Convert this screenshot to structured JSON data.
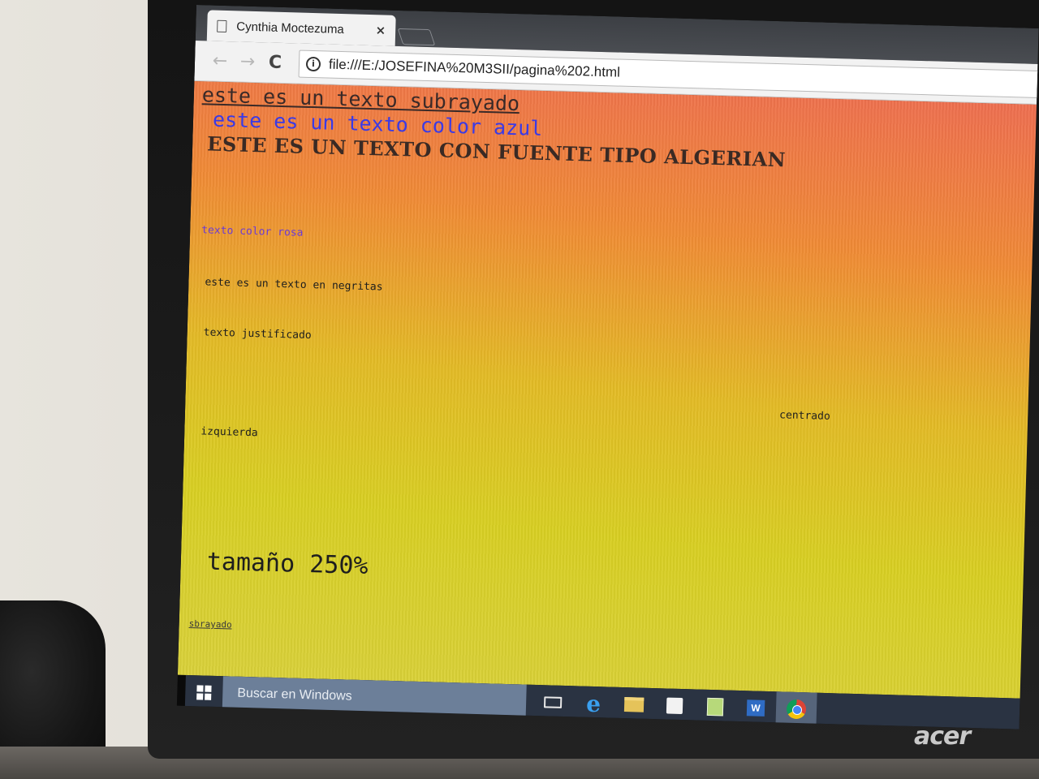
{
  "browser": {
    "tab_title": "Cynthia Moctezuma",
    "tab_close": "×",
    "url": "file:///E:/JOSEFINA%20M3SII/pagina%202.html",
    "back_glyph": "←",
    "forward_glyph": "→",
    "reload_glyph": "C",
    "info_glyph": "i"
  },
  "page": {
    "underlined_text": "este es un texto subrayado",
    "blue_text": "este es un texto color azul",
    "algerian_text": "ESTE ES UN TEXTO CON FUENTE TIPO ALGERIAN",
    "pink_text": "texto color rosa",
    "bold_text": "este es un texto en negritas",
    "justified_text": "texto justificado",
    "centered_text": "centrado",
    "left_text": "izquierda",
    "size_text": "tamaño 250%",
    "sub_text": " sbrayado "
  },
  "taskbar": {
    "search_placeholder": "Buscar en Windows",
    "word_glyph": "W",
    "edge_glyph": "e"
  },
  "monitor": {
    "brand": "acer"
  },
  "colors": {
    "page_gradient_top": "#ee6e50",
    "page_gradient_bottom": "#d9d13a",
    "blue_text": "#3a3ae6",
    "pink_text": "#6b3bd6"
  }
}
